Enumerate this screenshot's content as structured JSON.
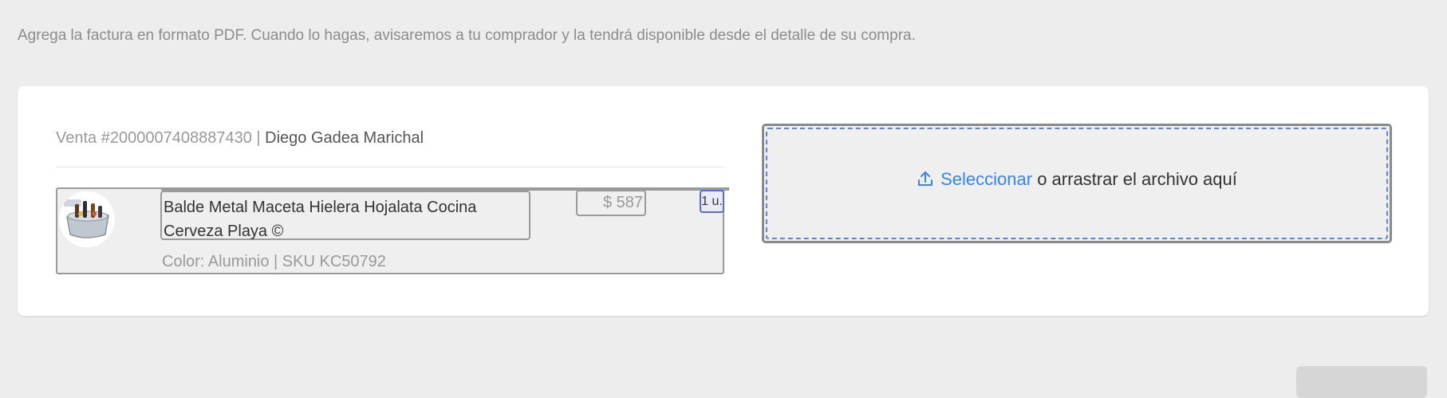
{
  "intro": {
    "text": "Agrega la factura en formato PDF. Cuando lo hagas, avisaremos a tu comprador y la tendrá disponible desde el detalle de su compra."
  },
  "sale": {
    "number_label": "Venta #2000007408887430 |",
    "buyer_name": "Diego Gadea Marichal"
  },
  "item": {
    "title": "Balde Metal Maceta Hielera Hojalata Cocina Cerveza Playa ©",
    "price": "$ 587",
    "quantity": "1 u.",
    "variant": "Color: Aluminio | SKU KC50792",
    "thumbnail_icon": "product-photo-icon"
  },
  "dropzone": {
    "icon": "upload-icon",
    "link_label": "Seleccionar",
    "rest_label": "o arrastrar el archivo aquí"
  },
  "colors": {
    "link": "#3483fa",
    "dashed_border": "#5b86d6",
    "qty_border": "#5b6ad8",
    "page_background": "#ededed"
  }
}
